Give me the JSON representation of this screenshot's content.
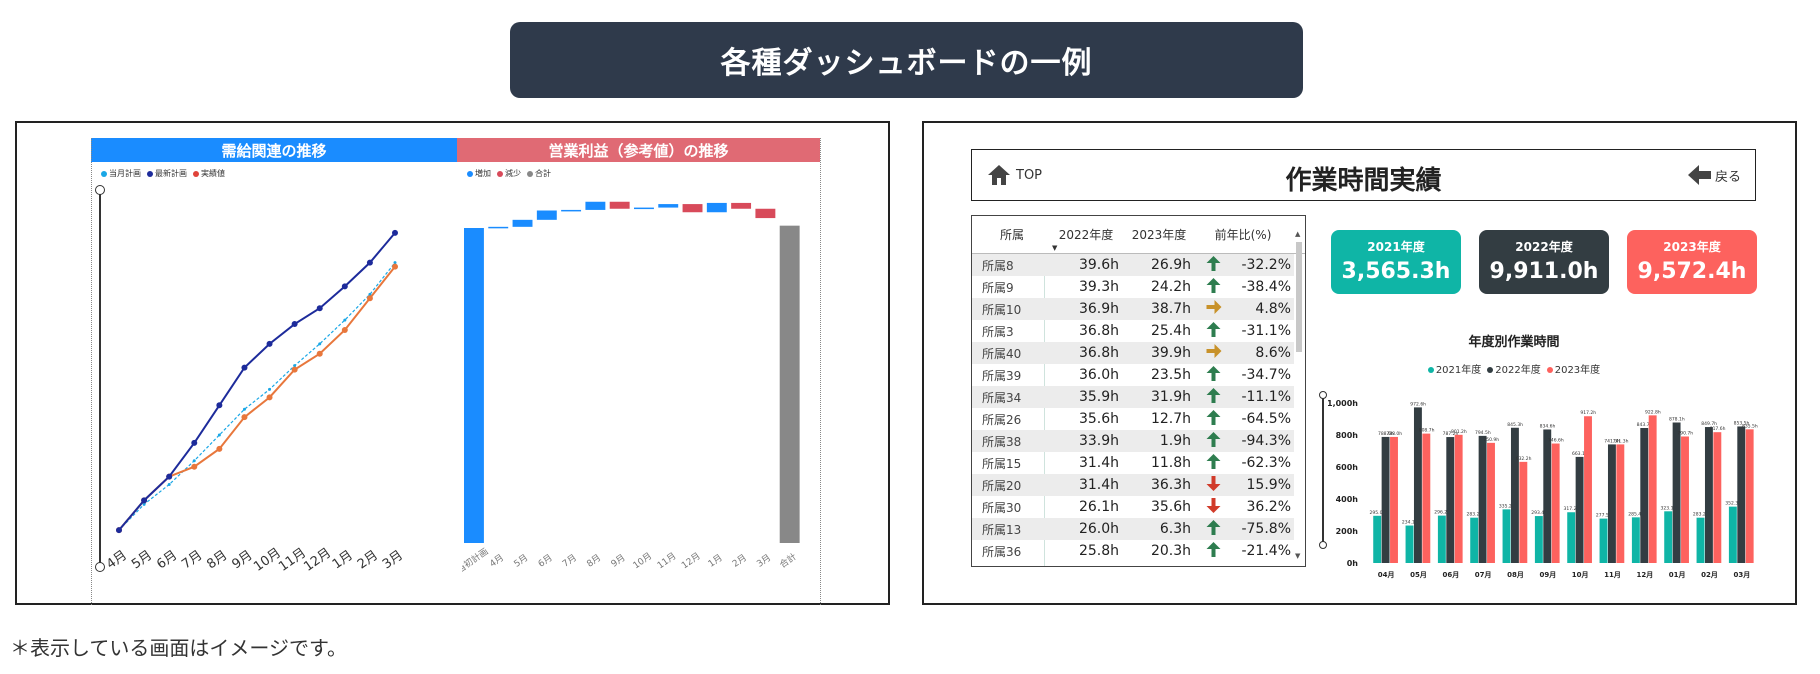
{
  "banner": {
    "title": "各種ダッシュボードの一例"
  },
  "footnote": "＊表示している画面はイメージです。",
  "left_panel": {
    "demand_header": "需給関連の推移",
    "profit_header": "営業利益（参考値）の推移",
    "line_legend": [
      {
        "name": "当月計画",
        "color": "#19a7e6"
      },
      {
        "name": "最新計画",
        "color": "#1d2b9b"
      },
      {
        "name": "実績値",
        "color": "#e0433a"
      }
    ],
    "waterfall_legend": [
      {
        "name": "増加",
        "color": "#1a8cff"
      },
      {
        "name": "減少",
        "color": "#d84a5a"
      },
      {
        "name": "合計",
        "color": "#888888"
      }
    ]
  },
  "right_panel": {
    "home_label": "TOP",
    "title": "作業時間実績",
    "back_label": "戻る",
    "table": {
      "headers": [
        "所属",
        "2022年度",
        "2023年度",
        "前年比(%)"
      ],
      "rows": [
        {
          "dept": "所属8",
          "y2022": "39.6h",
          "y2023": "26.9h",
          "trend": "up",
          "pct": "-32.2%"
        },
        {
          "dept": "所属9",
          "y2022": "39.3h",
          "y2023": "24.2h",
          "trend": "up",
          "pct": "-38.4%"
        },
        {
          "dept": "所属10",
          "y2022": "36.9h",
          "y2023": "38.7h",
          "trend": "flat",
          "pct": "4.8%"
        },
        {
          "dept": "所属3",
          "y2022": "36.8h",
          "y2023": "25.4h",
          "trend": "up",
          "pct": "-31.1%"
        },
        {
          "dept": "所属40",
          "y2022": "36.8h",
          "y2023": "39.9h",
          "trend": "flat",
          "pct": "8.6%"
        },
        {
          "dept": "所属39",
          "y2022": "36.0h",
          "y2023": "23.5h",
          "trend": "up",
          "pct": "-34.7%"
        },
        {
          "dept": "所属34",
          "y2022": "35.9h",
          "y2023": "31.9h",
          "trend": "up",
          "pct": "-11.1%"
        },
        {
          "dept": "所属26",
          "y2022": "35.6h",
          "y2023": "12.7h",
          "trend": "up",
          "pct": "-64.5%"
        },
        {
          "dept": "所属38",
          "y2022": "33.9h",
          "y2023": "1.9h",
          "trend": "up",
          "pct": "-94.3%"
        },
        {
          "dept": "所属15",
          "y2022": "31.4h",
          "y2023": "11.8h",
          "trend": "up",
          "pct": "-62.3%"
        },
        {
          "dept": "所属20",
          "y2022": "31.4h",
          "y2023": "36.3h",
          "trend": "down",
          "pct": "15.9%"
        },
        {
          "dept": "所属30",
          "y2022": "26.1h",
          "y2023": "35.6h",
          "trend": "down",
          "pct": "36.2%"
        },
        {
          "dept": "所属13",
          "y2022": "26.0h",
          "y2023": "6.3h",
          "trend": "up",
          "pct": "-75.8%"
        },
        {
          "dept": "所属36",
          "y2022": "25.8h",
          "y2023": "20.3h",
          "trend": "up",
          "pct": "-21.4%"
        }
      ]
    },
    "cards": [
      {
        "label": "2021年度",
        "value": "3,565.3h",
        "color": "#0fb5a6"
      },
      {
        "label": "2022年度",
        "value": "9,911.0h",
        "color": "#333d42"
      },
      {
        "label": "2023年度",
        "value": "9,572.4h",
        "color": "#fd625e"
      }
    ],
    "bar_title": "年度別作業時間",
    "arrow_colors": {
      "up": "#2e7d4f",
      "flat": "#c8922a",
      "down": "#d13b2a"
    }
  },
  "chart_data": [
    {
      "type": "line",
      "title": "需給関連の推移",
      "categories": [
        "4月",
        "5月",
        "6月",
        "7月",
        "8月",
        "9月",
        "10月",
        "11月",
        "12月",
        "1月",
        "2月",
        "3月"
      ],
      "series": [
        {
          "name": "当月計画",
          "color": "#19a7e6",
          "values": [
            5,
            18,
            28,
            40,
            53,
            66,
            76,
            88,
            99,
            111,
            124,
            140
          ]
        },
        {
          "name": "最新計画",
          "color": "#1d2b9b",
          "values": [
            5,
            20,
            32,
            49,
            68,
            87,
            99,
            109,
            117,
            128,
            140,
            155
          ]
        },
        {
          "name": "実績値",
          "color": "#e8773c",
          "values": [
            5,
            20,
            32,
            37,
            46,
            62,
            72,
            86,
            94,
            106,
            122,
            138
          ]
        }
      ],
      "ylim": [
        0,
        160
      ],
      "grid": false,
      "legend": "top-left"
    },
    {
      "type": "bar",
      "title": "営業利益（参考値）の推移",
      "subtype": "waterfall",
      "categories": [
        "当初計画",
        "4月",
        "5月",
        "6月",
        "7月",
        "8月",
        "9月",
        "10月",
        "11月",
        "12月",
        "1月",
        "2月",
        "3月",
        "合計"
      ],
      "values": [
        270,
        1,
        6,
        8,
        0.5,
        7,
        -6,
        1,
        3,
        -7,
        8,
        -5,
        -8,
        272
      ],
      "ylim": [
        0,
        300
      ],
      "legend": "top-left"
    },
    {
      "type": "bar",
      "title": "年度別作業時間",
      "categories": [
        "04月",
        "05月",
        "06月",
        "07月",
        "08月",
        "09月",
        "10月",
        "11月",
        "12月",
        "01月",
        "02月",
        "03月"
      ],
      "series": [
        {
          "name": "2021年度",
          "color": "#0fb5a6",
          "values": [
            295.0,
            234.1,
            296.2,
            283.2,
            335.2,
            293.4,
            317.2,
            277.5,
            285.4,
            323.1,
            283.2,
            352.3
          ]
        },
        {
          "name": "2022年度",
          "color": "#333d42",
          "values": [
            788.0,
            972.6,
            787.2,
            794.5,
            845.3,
            834.6,
            663.1,
            741.3,
            843.7,
            878.1,
            849.7,
            853.5
          ]
        },
        {
          "name": "2023年度",
          "color": "#fd625e",
          "values": [
            788.0,
            808.7,
            801.2,
            750.9,
            632.2,
            746.6,
            917.2,
            741.3,
            922.8,
            790.7,
            817.6,
            835.5
          ]
        }
      ],
      "yticks": [
        "0h",
        "200h",
        "400h",
        "600h",
        "800h",
        "1,000h"
      ],
      "ylim": [
        0,
        1000
      ],
      "legend": "top"
    }
  ]
}
